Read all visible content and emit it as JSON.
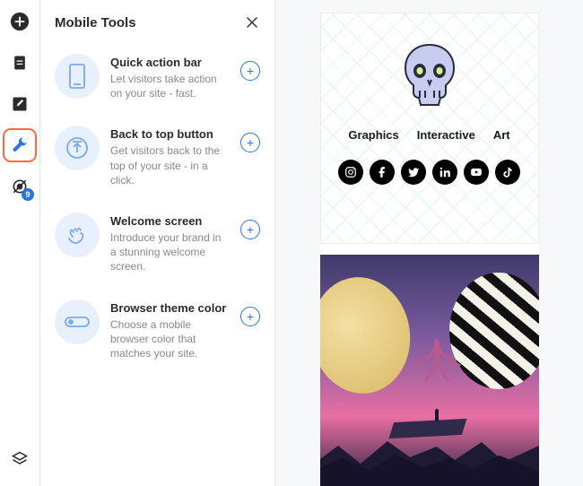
{
  "toolbar": {
    "badge_count": "9",
    "icons": [
      "add",
      "document",
      "edit",
      "wrench",
      "preview",
      "layers"
    ]
  },
  "panel": {
    "title": "Mobile Tools",
    "items": [
      {
        "title": "Quick action bar",
        "desc": "Let visitors take action on your site - fast."
      },
      {
        "title": "Back to top button",
        "desc": "Get visitors back to the top of your site - in a click."
      },
      {
        "title": "Welcome screen",
        "desc": "Introduce your brand in a stunning welcome screen."
      },
      {
        "title": "Browser theme color",
        "desc": "Choose a mobile browser color that matches your site."
      }
    ],
    "add_label": "+"
  },
  "preview": {
    "nav": [
      "Graphics",
      "Interactive",
      "Art"
    ],
    "social": [
      "instagram",
      "facebook",
      "twitter",
      "linkedin",
      "youtube",
      "tiktok"
    ]
  }
}
